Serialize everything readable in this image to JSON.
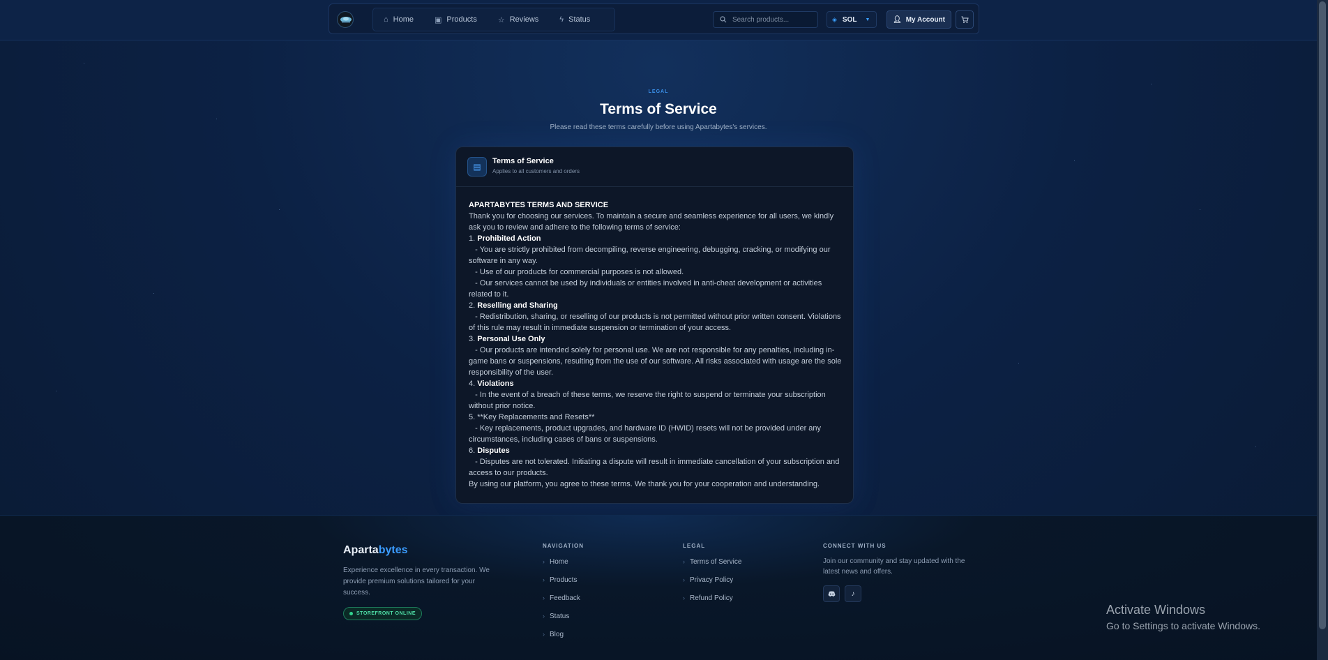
{
  "header": {
    "nav": [
      {
        "label": "Home",
        "icon": "home-icon"
      },
      {
        "label": "Products",
        "icon": "box-icon"
      },
      {
        "label": "Reviews",
        "icon": "star-icon"
      },
      {
        "label": "Status",
        "icon": "bolt-icon"
      }
    ],
    "search_placeholder": "Search products...",
    "currency": "SOL",
    "account_label": "My Account"
  },
  "hero": {
    "eyebrow": "LEGAL",
    "title": "Terms of Service",
    "subtitle": "Please read these terms carefully before using Apartabytes's services."
  },
  "card": {
    "title": "Terms of Service",
    "subtitle": "Applies to all customers and orders",
    "heading": "APARTABYTES TERMS AND SERVICE",
    "intro": "Thank you for choosing our services. To maintain a secure and seamless experience for all users, we kindly ask you to review and adhere to the following terms of service:",
    "s1_num": "1.",
    "s1_title": "Prohibited Action",
    "s1_l1": "- You are strictly prohibited from decompiling, reverse engineering, debugging, cracking, or modifying our software in any way.",
    "s1_l2": "- Use of our products for commercial purposes is not allowed.",
    "s1_l3": "- Our services cannot be used by individuals or entities involved in anti-cheat development or activities related to it.",
    "s2_num": "2.",
    "s2_title": "Reselling and Sharing",
    "s2_l1": "- Redistribution, sharing, or reselling of our products is not permitted without prior written consent. Violations of this rule may result in immediate suspension or termination of your access.",
    "s3_num": "3.",
    "s3_title": "Personal Use Only",
    "s3_l1": "- Our products are intended solely for personal use. We are not responsible for any penalties, including in-game bans or suspensions, resulting from the use of our software. All risks associated with usage are the sole responsibility of the user.",
    "s4_num": "4.",
    "s4_title": "Violations",
    "s4_l1": "- In the event of a breach of these terms, we reserve the right to suspend or terminate your subscription without prior notice.",
    "s5_line": "5. **Key Replacements and Resets**",
    "s5_l1": "- Key replacements, product upgrades, and hardware ID (HWID) resets will not be provided under any circumstances, including cases of bans or suspensions.",
    "s6_num": "6.",
    "s6_title": "Disputes",
    "s6_l1": "- Disputes are not tolerated. Initiating a dispute will result in immediate cancellation of your subscription and access to our products.",
    "closing": "By using our platform, you agree to these terms. We thank you for your cooperation and understanding."
  },
  "footer": {
    "brand_part1": "Aparta",
    "brand_part2": "bytes",
    "description": "Experience excellence in every transaction. We provide premium solutions tailored for your success.",
    "status_badge": "STOREFRONT ONLINE",
    "nav_heading": "NAVIGATION",
    "nav_links": [
      "Home",
      "Products",
      "Feedback",
      "Status",
      "Blog"
    ],
    "legal_heading": "LEGAL",
    "legal_links": [
      "Terms of Service",
      "Privacy Policy",
      "Refund Policy"
    ],
    "connect_heading": "CONNECT WITH US",
    "connect_text": "Join our community and stay updated with the latest news and offers.",
    "socials": [
      "discord-icon",
      "tiktok-icon"
    ]
  },
  "watermark": {
    "line1": "Activate Windows",
    "line2": "Go to Settings to activate Windows."
  },
  "colors": {
    "accent": "#3b9cff",
    "background": "#0b1c36",
    "online": "#32d48f"
  }
}
